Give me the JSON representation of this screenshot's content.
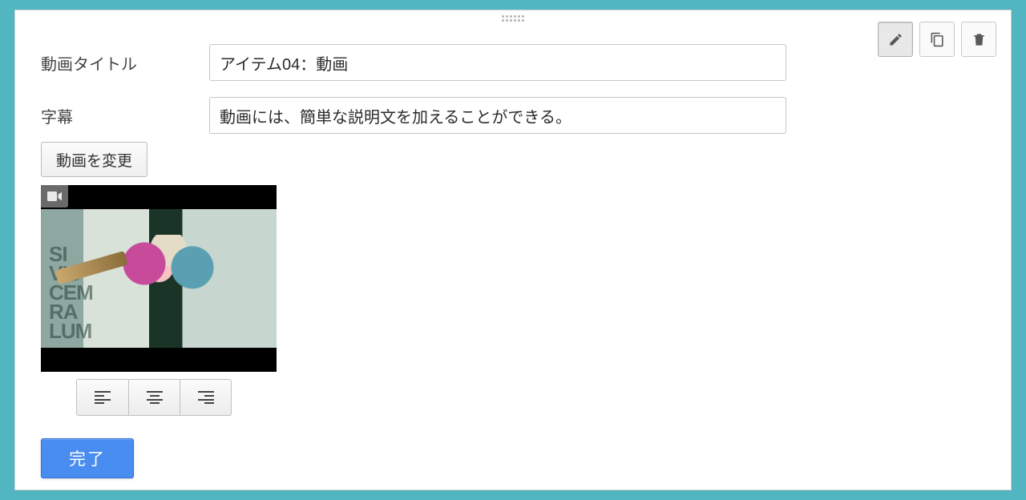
{
  "labels": {
    "title": "動画タイトル",
    "caption": "字幕"
  },
  "inputs": {
    "title": "アイテム04：動画",
    "caption": "動画には、簡単な説明文を加えることができる。"
  },
  "buttons": {
    "change_video": "動画を変更",
    "done": "完了"
  },
  "thumbnail": {
    "graffiti_text": "SI\nVIS\nCEM\nRA\nLUM"
  },
  "toolbar": {
    "edit": "edit",
    "duplicate": "duplicate",
    "delete": "delete"
  },
  "align": {
    "left": "align-left",
    "center": "align-center",
    "right": "align-right"
  }
}
